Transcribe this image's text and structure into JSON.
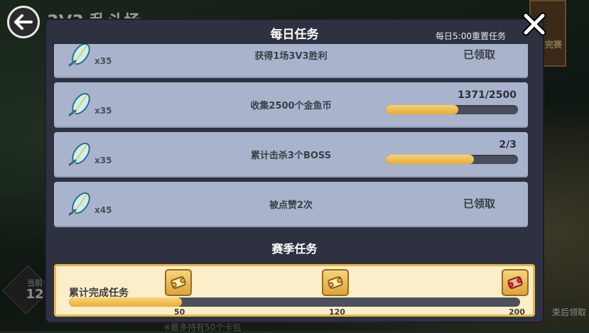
{
  "background": {
    "scene_title": "3V3 乱斗场",
    "left_badge_label": "当前",
    "left_badge_value": "12",
    "right_label": "束后领取",
    "end_badge": "完赛",
    "bottom_note": "※最多持有50个卡包"
  },
  "dialog": {
    "title": "每日任务",
    "reset_note": "每日5:00重置任务"
  },
  "daily_tasks": [
    {
      "reward_qty": "x35",
      "description": "获得1场3V3胜利",
      "status": "已领取"
    },
    {
      "reward_qty": "x35",
      "description": "收集2500个金鱼币",
      "progress_text": "1371/2500",
      "progress": 0.5484
    },
    {
      "reward_qty": "x35",
      "description": "累计击杀3个BOSS",
      "progress_text": "2/3",
      "progress": 0.6667
    },
    {
      "reward_qty": "x45",
      "description": "被点赞2次",
      "status": "已领取"
    }
  ],
  "season": {
    "title": "赛季任务",
    "label": "累计完成任务",
    "progress_value": 50,
    "max": 200,
    "milestones": [
      {
        "value": "50",
        "icon": "gold-scroll-icon"
      },
      {
        "value": "120",
        "icon": "gold-scroll-icon"
      },
      {
        "value": "200",
        "icon": "red-scroll-icon"
      }
    ]
  },
  "colors": {
    "accent_gold": "#e7ad33",
    "task_card": "#a9b4cc",
    "dialog_bg": "#2e3140"
  }
}
